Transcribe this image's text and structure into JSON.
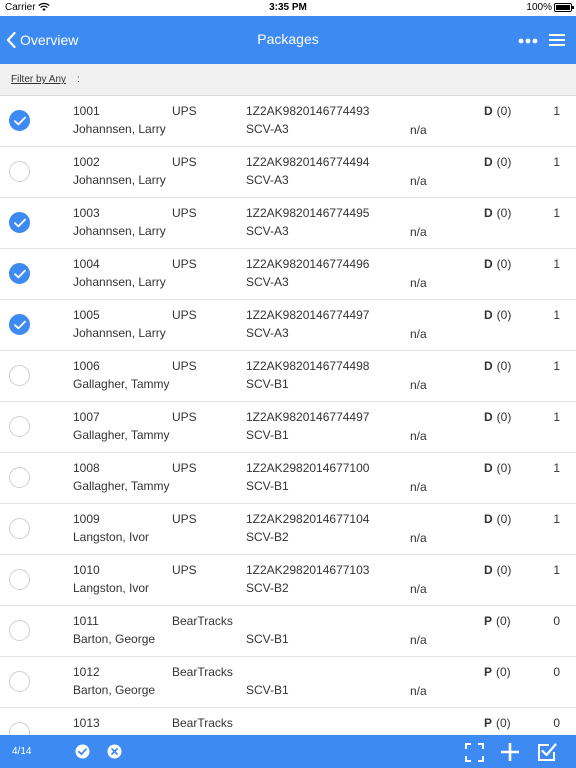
{
  "status_bar": {
    "carrier": "Carrier",
    "time": "3:35 PM",
    "battery": "100%"
  },
  "nav": {
    "back_label": "Overview",
    "title": "Packages"
  },
  "filter": {
    "label": "Filter by Any",
    "colon": ":"
  },
  "toolbar": {
    "count": "4/14"
  },
  "colors": {
    "accent": "#3d8af2"
  },
  "rows": [
    {
      "id": "1001",
      "carrier": "UPS",
      "tracking": "1Z2AK9820146774493",
      "recipient": "Johannsen, Larry",
      "location": "SCV-A3",
      "note": "n/a",
      "status_code": "D",
      "status_count": "(0)",
      "qty": "1",
      "checked": true
    },
    {
      "id": "1002",
      "carrier": "UPS",
      "tracking": "1Z2AK9820146774494",
      "recipient": "Johannsen, Larry",
      "location": "SCV-A3",
      "note": "n/a",
      "status_code": "D",
      "status_count": "(0)",
      "qty": "1",
      "checked": false
    },
    {
      "id": "1003",
      "carrier": "UPS",
      "tracking": "1Z2AK9820146774495",
      "recipient": "Johannsen, Larry",
      "location": "SCV-A3",
      "note": "n/a",
      "status_code": "D",
      "status_count": "(0)",
      "qty": "1",
      "checked": true
    },
    {
      "id": "1004",
      "carrier": "UPS",
      "tracking": "1Z2AK9820146774496",
      "recipient": "Johannsen, Larry",
      "location": "SCV-A3",
      "note": "n/a",
      "status_code": "D",
      "status_count": "(0)",
      "qty": "1",
      "checked": true
    },
    {
      "id": "1005",
      "carrier": "UPS",
      "tracking": "1Z2AK9820146774497",
      "recipient": "Johannsen, Larry",
      "location": "SCV-A3",
      "note": "n/a",
      "status_code": "D",
      "status_count": "(0)",
      "qty": "1",
      "checked": true
    },
    {
      "id": "1006",
      "carrier": "UPS",
      "tracking": "1Z2AK9820146774498",
      "recipient": "Gallagher, Tammy",
      "location": "SCV-B1",
      "note": "n/a",
      "status_code": "D",
      "status_count": "(0)",
      "qty": "1",
      "checked": false
    },
    {
      "id": "1007",
      "carrier": "UPS",
      "tracking": "1Z2AK9820146774497",
      "recipient": "Gallagher, Tammy",
      "location": "SCV-B1",
      "note": "n/a",
      "status_code": "D",
      "status_count": "(0)",
      "qty": "1",
      "checked": false
    },
    {
      "id": "1008",
      "carrier": "UPS",
      "tracking": "1Z2AK2982014677100",
      "recipient": "Gallagher, Tammy",
      "location": "SCV-B1",
      "note": "n/a",
      "status_code": "D",
      "status_count": "(0)",
      "qty": "1",
      "checked": false
    },
    {
      "id": "1009",
      "carrier": "UPS",
      "tracking": "1Z2AK2982014677104",
      "recipient": "Langston, Ivor",
      "location": "SCV-B2",
      "note": "n/a",
      "status_code": "D",
      "status_count": "(0)",
      "qty": "1",
      "checked": false
    },
    {
      "id": "1010",
      "carrier": "UPS",
      "tracking": "1Z2AK2982014677103",
      "recipient": "Langston, Ivor",
      "location": "SCV-B2",
      "note": "n/a",
      "status_code": "D",
      "status_count": "(0)",
      "qty": "1",
      "checked": false
    },
    {
      "id": "1011",
      "carrier": "BearTracks",
      "tracking": "",
      "recipient": "Barton, George",
      "location": "SCV-B1",
      "note": "n/a",
      "status_code": "P",
      "status_count": "(0)",
      "qty": "0",
      "checked": false
    },
    {
      "id": "1012",
      "carrier": "BearTracks",
      "tracking": "",
      "recipient": "Barton, George",
      "location": "SCV-B1",
      "note": "n/a",
      "status_code": "P",
      "status_count": "(0)",
      "qty": "0",
      "checked": false
    },
    {
      "id": "1013",
      "carrier": "BearTracks",
      "tracking": "",
      "recipient": "",
      "location": "",
      "note": "",
      "status_code": "P",
      "status_count": "(0)",
      "qty": "0",
      "checked": false
    }
  ]
}
